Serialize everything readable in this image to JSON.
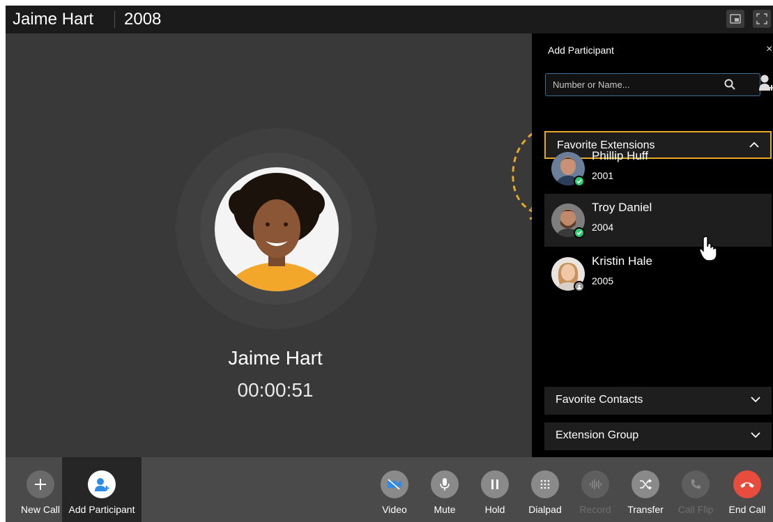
{
  "titlebar": {
    "caller_name": "Jaime Hart",
    "extension": "2008",
    "icons": [
      "picture-in-picture-icon",
      "fullscreen-icon"
    ]
  },
  "call": {
    "caller_name": "Jaime Hart",
    "duration": "00:00:51"
  },
  "panel": {
    "title": "Add Participant",
    "close_icon": "close-icon",
    "search_placeholder": "Number or Name...",
    "sections": {
      "favorite_extensions": {
        "label": "Favorite Extensions",
        "expanded": true
      },
      "favorite_contacts": {
        "label": "Favorite Contacts",
        "expanded": false
      },
      "extension_group": {
        "label": "Extension Group",
        "expanded": false
      }
    },
    "contacts": [
      {
        "name": "Phillip Huff",
        "ext": "2001",
        "status": "available"
      },
      {
        "name": "Troy Daniel",
        "ext": "2004",
        "status": "available"
      },
      {
        "name": "Kristin Hale",
        "ext": "2005",
        "status": "offline"
      }
    ]
  },
  "actions": {
    "new_call": "New Call",
    "add_participant": "Add Participant",
    "video": "Video",
    "mute": "Mute",
    "hold": "Hold",
    "dialpad": "Dialpad",
    "record": "Record",
    "transfer": "Transfer",
    "call_flip": "Call Flip",
    "end_call": "End Call"
  },
  "colors": {
    "accent_blue": "#2f8be8",
    "highlight": "#e8a825",
    "available": "#2ecc71",
    "end_call": "#e74c3c"
  }
}
